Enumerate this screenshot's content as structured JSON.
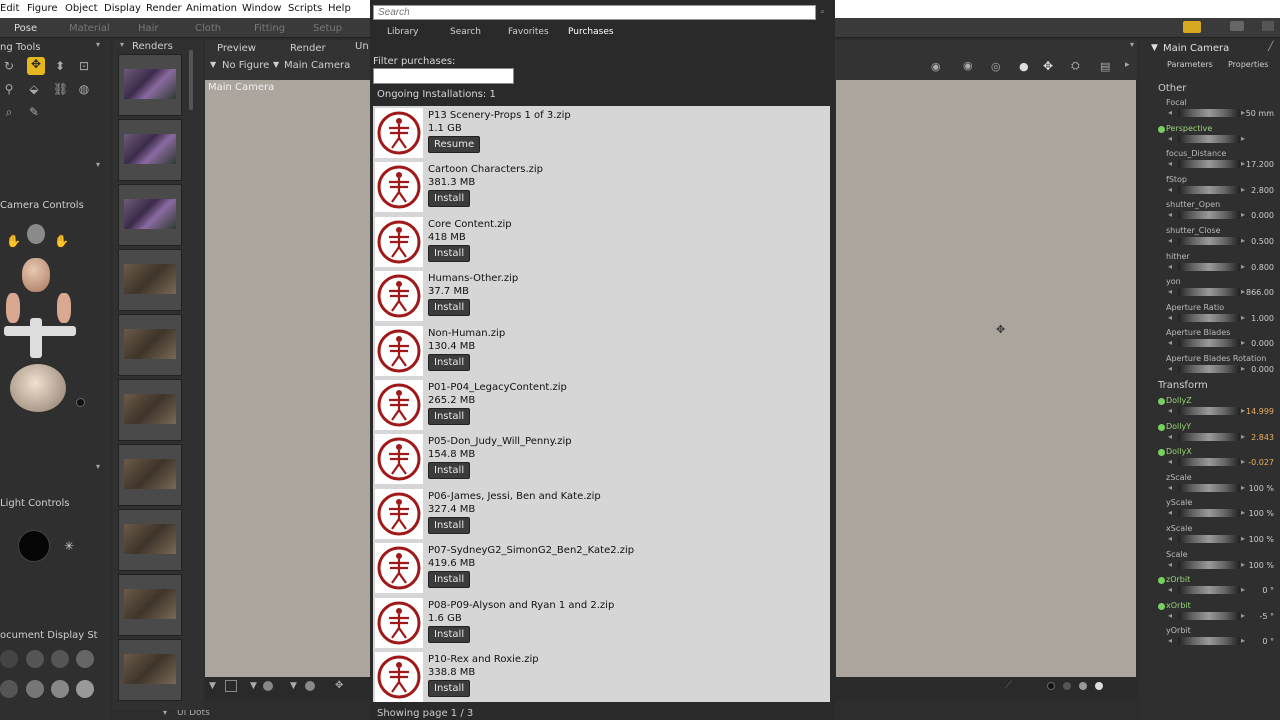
{
  "menu": [
    "Edit",
    "Figure",
    "Object",
    "Display",
    "Render",
    "Animation",
    "Window",
    "Scripts",
    "Help"
  ],
  "room_tabs": [
    "Pose",
    "Material",
    "Hair",
    "Cloth",
    "Fitting",
    "Setup"
  ],
  "left_panel": {
    "editing_tools": "ng Tools",
    "camera_controls": "Camera Controls",
    "light_controls": "Light Controls",
    "document_display": "ocument Display St",
    "ui_dots": "UI Dots"
  },
  "renders_panel": {
    "title": "Renders"
  },
  "viewport": {
    "tabs": [
      "Preview",
      "Render",
      "Un"
    ],
    "figure_select": "No Figure",
    "camera_select": "Main Camera",
    "camera_label": "Main Camera"
  },
  "smart_content": {
    "search_placeholder": "Search",
    "tabs": [
      "Library",
      "Search",
      "Favorites",
      "Purchases"
    ],
    "filter_label": "Filter purchases:",
    "filter_value": "",
    "ongoing": "Ongoing Installations: 1",
    "items": [
      {
        "name": "P13 Scenery-Props 1 of 3.zip",
        "size": "1.1 GB",
        "action": "Resume"
      },
      {
        "name": "Cartoon Characters.zip",
        "size": "381.3 MB",
        "action": "Install"
      },
      {
        "name": "Core Content.zip",
        "size": "418 MB",
        "action": "Install"
      },
      {
        "name": "Humans-Other.zip",
        "size": "37.7 MB",
        "action": "Install"
      },
      {
        "name": "Non-Human.zip",
        "size": "130.4 MB",
        "action": "Install"
      },
      {
        "name": "P01-P04_LegacyContent.zip",
        "size": "265.2 MB",
        "action": "Install"
      },
      {
        "name": "P05-Don_Judy_Will_Penny.zip",
        "size": "154.8 MB",
        "action": "Install"
      },
      {
        "name": "P06-James, Jessi, Ben and Kate.zip",
        "size": "327.4 MB",
        "action": "Install"
      },
      {
        "name": "P07-SydneyG2_SimonG2_Ben2_Kate2.zip",
        "size": "419.6 MB",
        "action": "Install"
      },
      {
        "name": "P08-P09-Alyson and Ryan 1 and 2.zip",
        "size": "1.6 GB",
        "action": "Install"
      },
      {
        "name": "P10-Rex and Roxie.zip",
        "size": "338.8 MB",
        "action": "Install"
      }
    ],
    "pagination": "Showing page 1 / 3"
  },
  "right_panel": {
    "title": "Main Camera",
    "tabs": [
      "Parameters",
      "Properties"
    ],
    "section_other": "Other",
    "section_transform": "Transform",
    "other_params": [
      {
        "name": "Focal",
        "value": "50 mm",
        "green": false
      },
      {
        "name": "Perspective",
        "value": "",
        "green": true
      },
      {
        "name": "focus_Distance",
        "value": "17.200",
        "green": false
      },
      {
        "name": "fStop",
        "value": "2.800",
        "green": false
      },
      {
        "name": "shutter_Open",
        "value": "0.000",
        "green": false
      },
      {
        "name": "shutter_Close",
        "value": "0.500",
        "green": false
      },
      {
        "name": "hither",
        "value": "0.800",
        "green": false
      },
      {
        "name": "yon",
        "value": "866.00",
        "green": false
      },
      {
        "name": "Aperture Ratio",
        "value": "1.000",
        "green": false
      },
      {
        "name": "Aperture Blades",
        "value": "0.000",
        "green": false
      },
      {
        "name": "Aperture Blades Rotation",
        "value": "0.000",
        "green": false
      }
    ],
    "transform_params": [
      {
        "name": "DollyZ",
        "value": "14.999",
        "green": true
      },
      {
        "name": "DollyY",
        "value": "2.843",
        "green": true
      },
      {
        "name": "DollyX",
        "value": "-0.027",
        "green": true
      },
      {
        "name": "zScale",
        "value": "100 %",
        "green": false
      },
      {
        "name": "yScale",
        "value": "100 %",
        "green": false
      },
      {
        "name": "xScale",
        "value": "100 %",
        "green": false
      },
      {
        "name": "Scale",
        "value": "100 %",
        "green": false
      },
      {
        "name": "zOrbit",
        "value": "0 °",
        "green": true
      },
      {
        "name": "xOrbit",
        "value": "-5 °",
        "green": true
      },
      {
        "name": "yOrbit",
        "value": "0 °",
        "green": false
      }
    ]
  }
}
